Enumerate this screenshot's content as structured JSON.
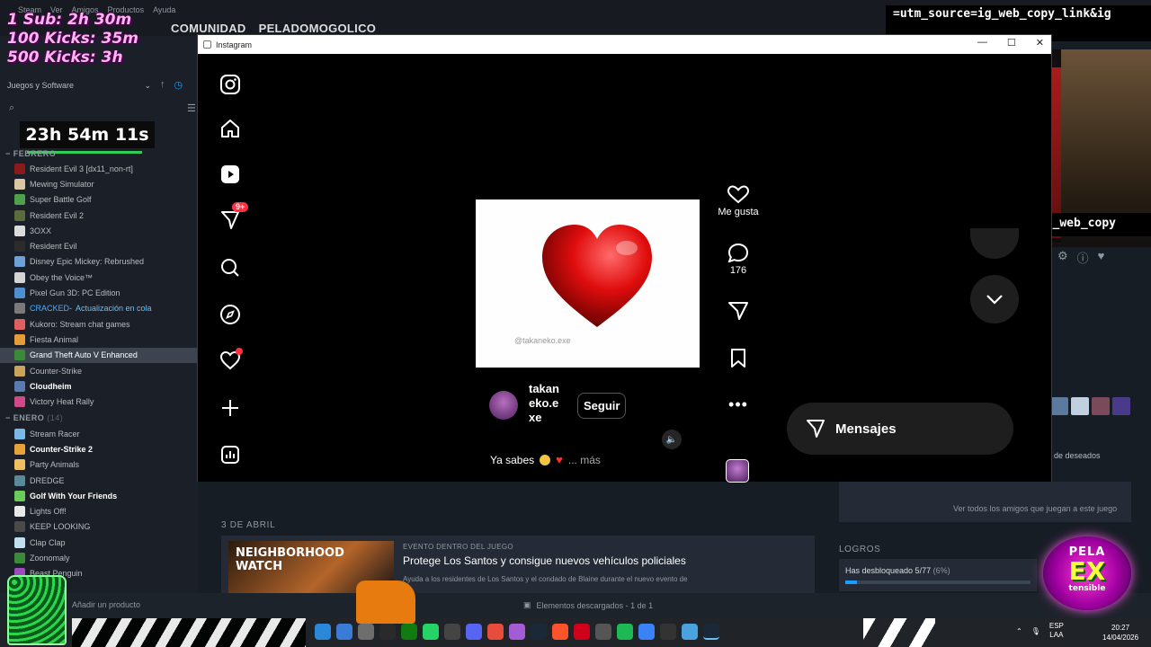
{
  "steam": {
    "menu": [
      "Steam",
      "Ver",
      "Amigos",
      "Productos",
      "Ayuda"
    ],
    "nav": [
      "COMUNIDAD",
      "PELADOMOGOLICO"
    ],
    "filter_label": "Juegos y Software",
    "search_placeholder": "",
    "sections": [
      {
        "name": "FEBRERO",
        "count": ""
      },
      {
        "name": "ENERO",
        "count": "(14)"
      }
    ],
    "february_games": [
      {
        "name": "Resident Evil 3 [dx11_non-rt]",
        "color": "#8b1a1a",
        "bold": false
      },
      {
        "name": "Mewing Simulator",
        "color": "#d9c7a3",
        "bold": false
      },
      {
        "name": "Super Battle Golf",
        "color": "#4fa04a",
        "bold": false
      },
      {
        "name": "Resident Evil 2",
        "color": "#5b6b3d",
        "bold": false
      },
      {
        "name": "3OXX",
        "color": "#dcdcdc",
        "bold": false
      },
      {
        "name": "Resident Evil",
        "color": "#2c2c2c",
        "bold": false
      },
      {
        "name": "Disney Epic Mickey: Rebrushed",
        "color": "#6fa0d8",
        "bold": false
      },
      {
        "name": "Obey the Voice™",
        "color": "#d4d4d4",
        "bold": false
      },
      {
        "name": "Pixel Gun 3D: PC Edition",
        "color": "#4f8fcf",
        "bold": false
      },
      {
        "name": "CRACKED",
        "color": "#7a7a7a",
        "bold": false,
        "cracked": true,
        "status": "Actualización en cola"
      },
      {
        "name": "Kukoro: Stream chat games",
        "color": "#e06060",
        "bold": false
      },
      {
        "name": "Fiesta Animal",
        "color": "#e49b3a",
        "bold": false
      },
      {
        "name": "Grand Theft Auto V Enhanced",
        "color": "#3a8a3a",
        "bold": false,
        "active": true
      },
      {
        "name": "Counter-Strike",
        "color": "#c9a55c",
        "bold": false
      },
      {
        "name": "Cloudheim",
        "color": "#5a7ab0",
        "bold": true
      },
      {
        "name": "Victory Heat Rally",
        "color": "#d04a8a",
        "bold": false
      }
    ],
    "january_games": [
      {
        "name": "Stream Racer",
        "color": "#7ab8e8",
        "bold": false
      },
      {
        "name": "Counter-Strike 2",
        "color": "#e8a23a",
        "bold": true
      },
      {
        "name": "Party Animals",
        "color": "#f0c060",
        "bold": false
      },
      {
        "name": "DREDGE",
        "color": "#5a8a9a",
        "bold": false
      },
      {
        "name": "Golf With Your Friends",
        "color": "#6acb5a",
        "bold": true
      },
      {
        "name": "Lights Off!",
        "color": "#e8e8e8",
        "bold": false
      },
      {
        "name": "KEEP LOOKING",
        "color": "#4a4a4a",
        "bold": false
      },
      {
        "name": "Clap Clap",
        "color": "#c0e0f0",
        "bold": false
      },
      {
        "name": "Zoonomaly",
        "color": "#3a8a3a",
        "bold": false
      },
      {
        "name": "Beast Penguin",
        "color": "#a04ac0",
        "bold": false
      }
    ],
    "add_product": "Añadir un producto",
    "download_status": "Elementos descargados - 1 de 1",
    "date_heading": "3 DE ABRIL",
    "event": {
      "image_text": "NEIGHBORHOOD WATCH",
      "tag": "EVENTO DENTRO DEL JUEGO",
      "title": "Protege Los Santos y consigue nuevos vehículos policiales",
      "desc": "Ayuda a los residentes de Los Santos y el condado de Blaine durante el nuevo evento de"
    },
    "friends_link": "Ver todos los amigos que juegan a este juego",
    "wishlist": "de deseados",
    "logros_heading": "LOGROS",
    "logros_text": "Has desbloqueado 5/77",
    "logros_pct": "(6%)",
    "logros_fraction": 0.065
  },
  "stream": {
    "overlay_lines": [
      "1 Sub: 2h 30m",
      "100 Kicks: 35m",
      "500 Kicks: 3h"
    ],
    "timer": "23h 54m 11s",
    "top_url": "=utm_source=ig_web_copy_link&ig",
    "mid_url": "IEIZA=?utm_source=ig_web_copy",
    "logo_top": "PELA",
    "logo_mid": "EX",
    "logo_bot": "tensible"
  },
  "instagram": {
    "window_title": "Instagram",
    "nav_badge": "9+",
    "reel": {
      "watermark": "@takaneko.exe",
      "username": "takan eko.e xe",
      "follow_label": "Seguir",
      "caption": "Ya sabes",
      "more_label": "... más"
    },
    "actions": {
      "like_label": "Me gusta",
      "comments_count": "176"
    },
    "messages_label": "Mensajes"
  },
  "taskbar": {
    "lang_top": "ESP",
    "lang_bottom": "LAA",
    "time": "20:27",
    "date": "14/04/2026"
  }
}
